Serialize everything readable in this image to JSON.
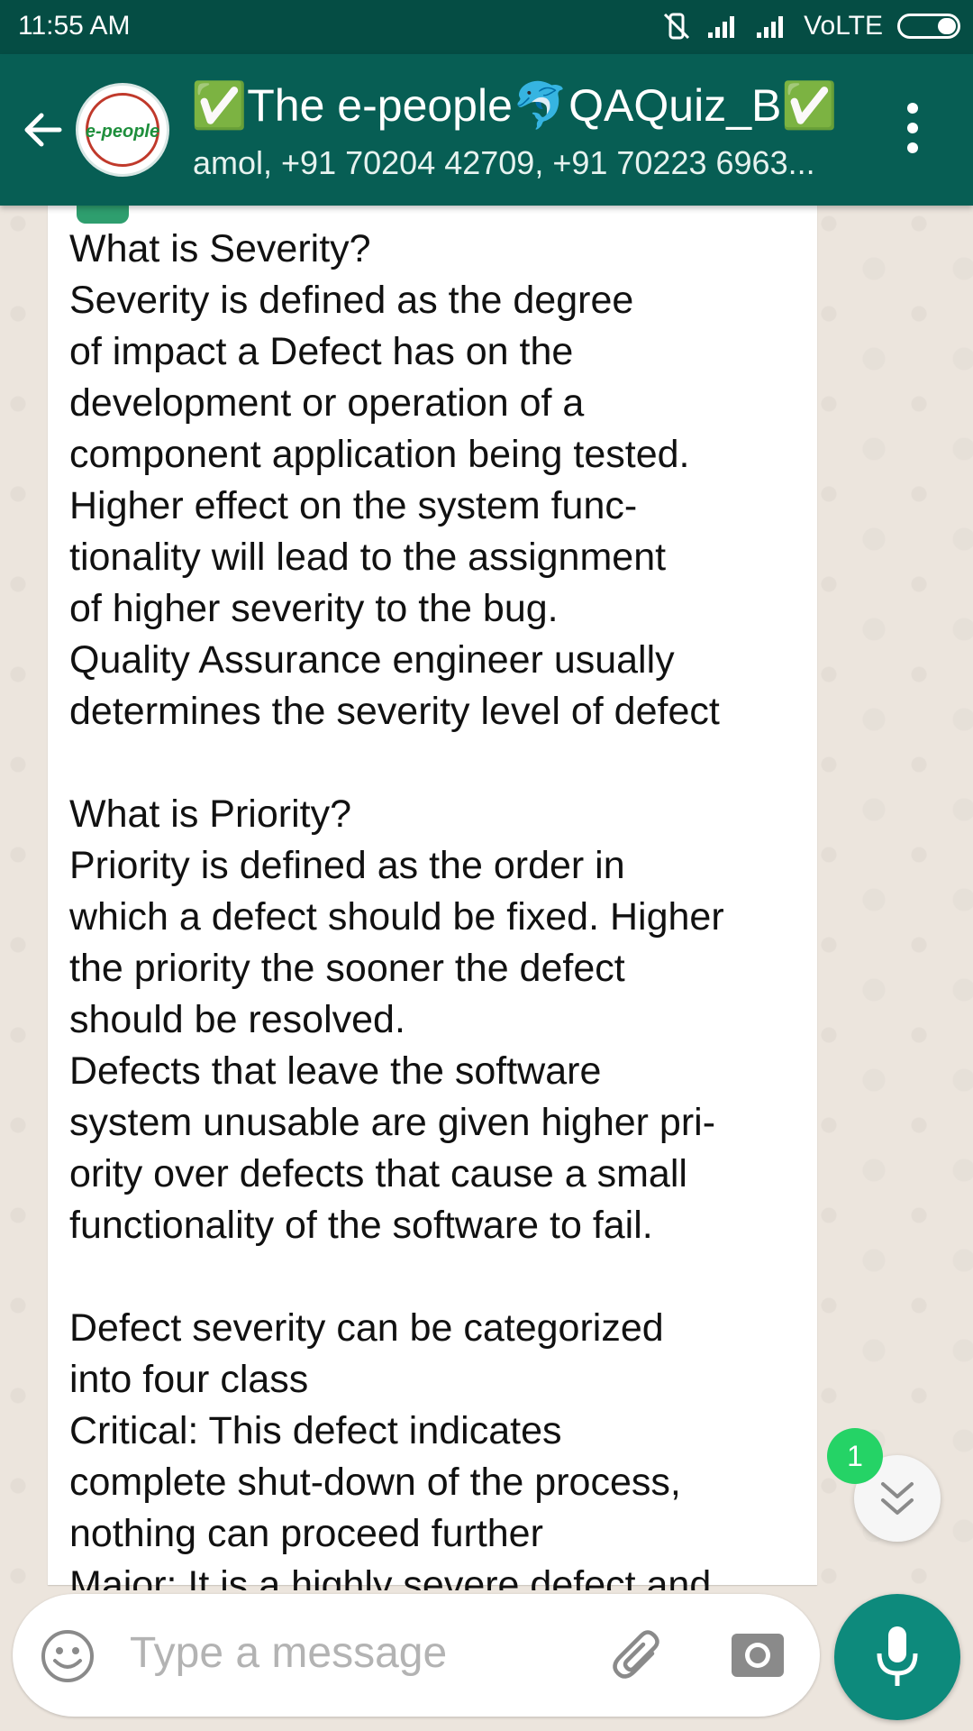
{
  "status_bar": {
    "time": "11:55 AM",
    "network": "VoLTE"
  },
  "header": {
    "avatar_text": "e-people",
    "title": "✅The e-people🐬QAQuiz_B✅",
    "participants": "amol, +91 70204 42709, +91 70223 6963..."
  },
  "message": {
    "lines": [
      "What is Severity?",
      "Severity is defined as the degree",
      "of impact a Defect has on the",
      "development or operation of a",
      "component application being tested.",
      "Higher effect on the system func-",
      "tionality will lead to the assignment",
      "of higher severity to the bug.",
      "Quality Assurance engineer usually",
      "determines the severity level of defect",
      "",
      "What is Priority?",
      "Priority is defined as the order in",
      "which a defect should be fixed. Higher",
      "the priority the sooner the defect",
      "should be resolved.",
      "Defects that leave the software",
      "system unusable are given higher pri-",
      "ority over defects that cause a small",
      "functionality of the software to fail.",
      "",
      "Defect severity can be categorized",
      "into four class",
      "Critical: This defect indicates",
      "complete shut-down of the process,",
      "nothing can proceed further",
      "Major: It is a highly severe defect and"
    ]
  },
  "scroll_down": {
    "unread_count": "1"
  },
  "input": {
    "placeholder": "Type a message"
  },
  "colors": {
    "header": "#075e54",
    "status_bar": "#054d44",
    "accent": "#25d366",
    "mic": "#0d8a7c"
  },
  "icons": [
    "back-arrow-icon",
    "more-vert-icon",
    "emoji-icon",
    "attach-icon",
    "camera-icon",
    "mic-icon",
    "chevron-down-icon"
  ]
}
